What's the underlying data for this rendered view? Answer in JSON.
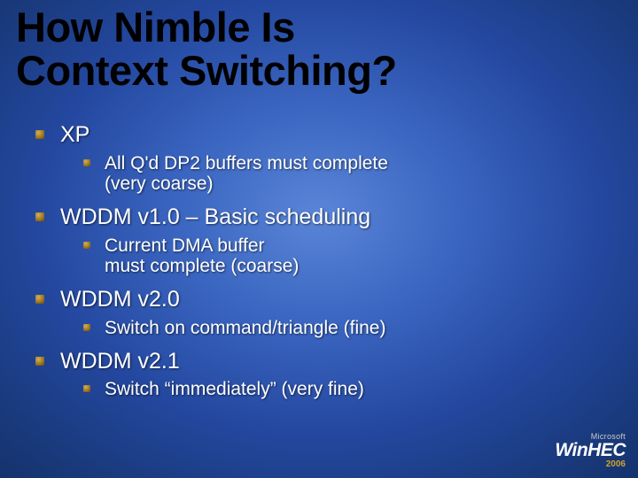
{
  "title_line1": "How Nimble Is",
  "title_line2": "Context Switching?",
  "bullets": {
    "b1": "XP",
    "b1_1a": "All Q'd DP2 buffers must complete",
    "b1_1b": "(very coarse)",
    "b2": "WDDM v1.0 – Basic scheduling",
    "b2_1a": "Current DMA buffer",
    "b2_1b": "must complete (coarse)",
    "b3": "WDDM v2.0",
    "b3_1": "Switch on command/triangle (fine)",
    "b4": "WDDM v2.1",
    "b4_1": "Switch “immediately” (very fine)"
  },
  "logo": {
    "top": "Microsoft",
    "main": "WinHEC",
    "year": "2006"
  }
}
